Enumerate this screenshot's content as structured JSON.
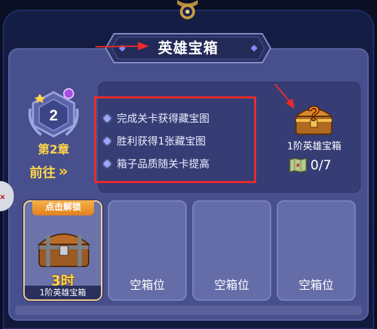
{
  "title": "英雄宝箱",
  "chapter": {
    "badge_number": "2",
    "name": "第2章",
    "goto_label": "前往",
    "goto_chevrons": "»"
  },
  "tips": [
    "完成关卡获得藏宝图",
    "胜利获得1张藏宝图",
    "箱子品质随关卡提高"
  ],
  "reward": {
    "chest_name": "1阶英雄宝箱",
    "map_count": "0/7"
  },
  "slots": {
    "active": {
      "unlock_label": "点击解锁",
      "time": "3时",
      "chest_name": "1阶英雄宝箱"
    },
    "empty_label": "空箱位"
  },
  "colors": {
    "accent_gold": "#ffd54a",
    "highlight_red": "#ec2b2b",
    "panel": "#474f8c"
  }
}
